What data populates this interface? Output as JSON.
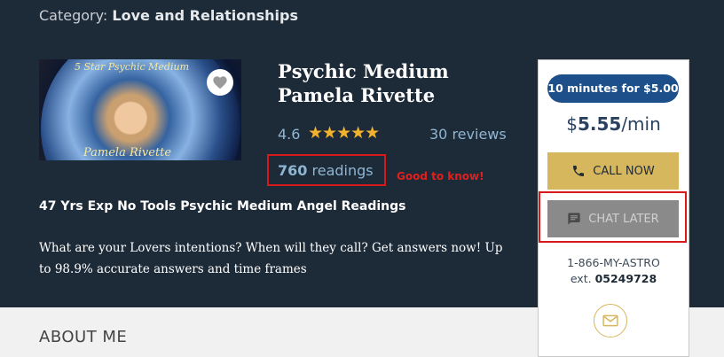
{
  "category": {
    "label": "Category:",
    "value": "Love and Relationships"
  },
  "profile": {
    "photo_text_top": "5 Star Psychic Medium",
    "photo_text_bottom": "Pamela Rivette",
    "name": "Psychic Medium Pamela Rivette",
    "rating": "4.6",
    "stars": "★★★★★",
    "reviews_count": "30",
    "reviews_label": "reviews",
    "readings_count": "760",
    "readings_label": "readings",
    "annotation": "Good to know!",
    "tagline": "47 Yrs Exp No Tools Psychic Medium Angel Readings",
    "description": "What are your Lovers intentions? When will they call? Get answers now! Up to 98.9% accurate answers and time frames"
  },
  "sidebar": {
    "promo": "10 minutes for $5.00",
    "price_currency": "$",
    "price_value": "5.55",
    "price_unit": "/min",
    "call_now": "CALL NOW",
    "chat_later": "CHAT LATER",
    "phone": "1-866-MY-ASTRO",
    "ext_label": "ext.",
    "ext_value": "05249728"
  },
  "section": {
    "about_me": "ABOUT ME"
  },
  "colors": {
    "background": "#1d2a38",
    "gold": "#d6b75e",
    "promo": "#1d4f8a",
    "highlight": "#d7191c"
  },
  "icons": [
    "heart-icon",
    "phone-icon",
    "chat-icon",
    "mail-icon"
  ]
}
